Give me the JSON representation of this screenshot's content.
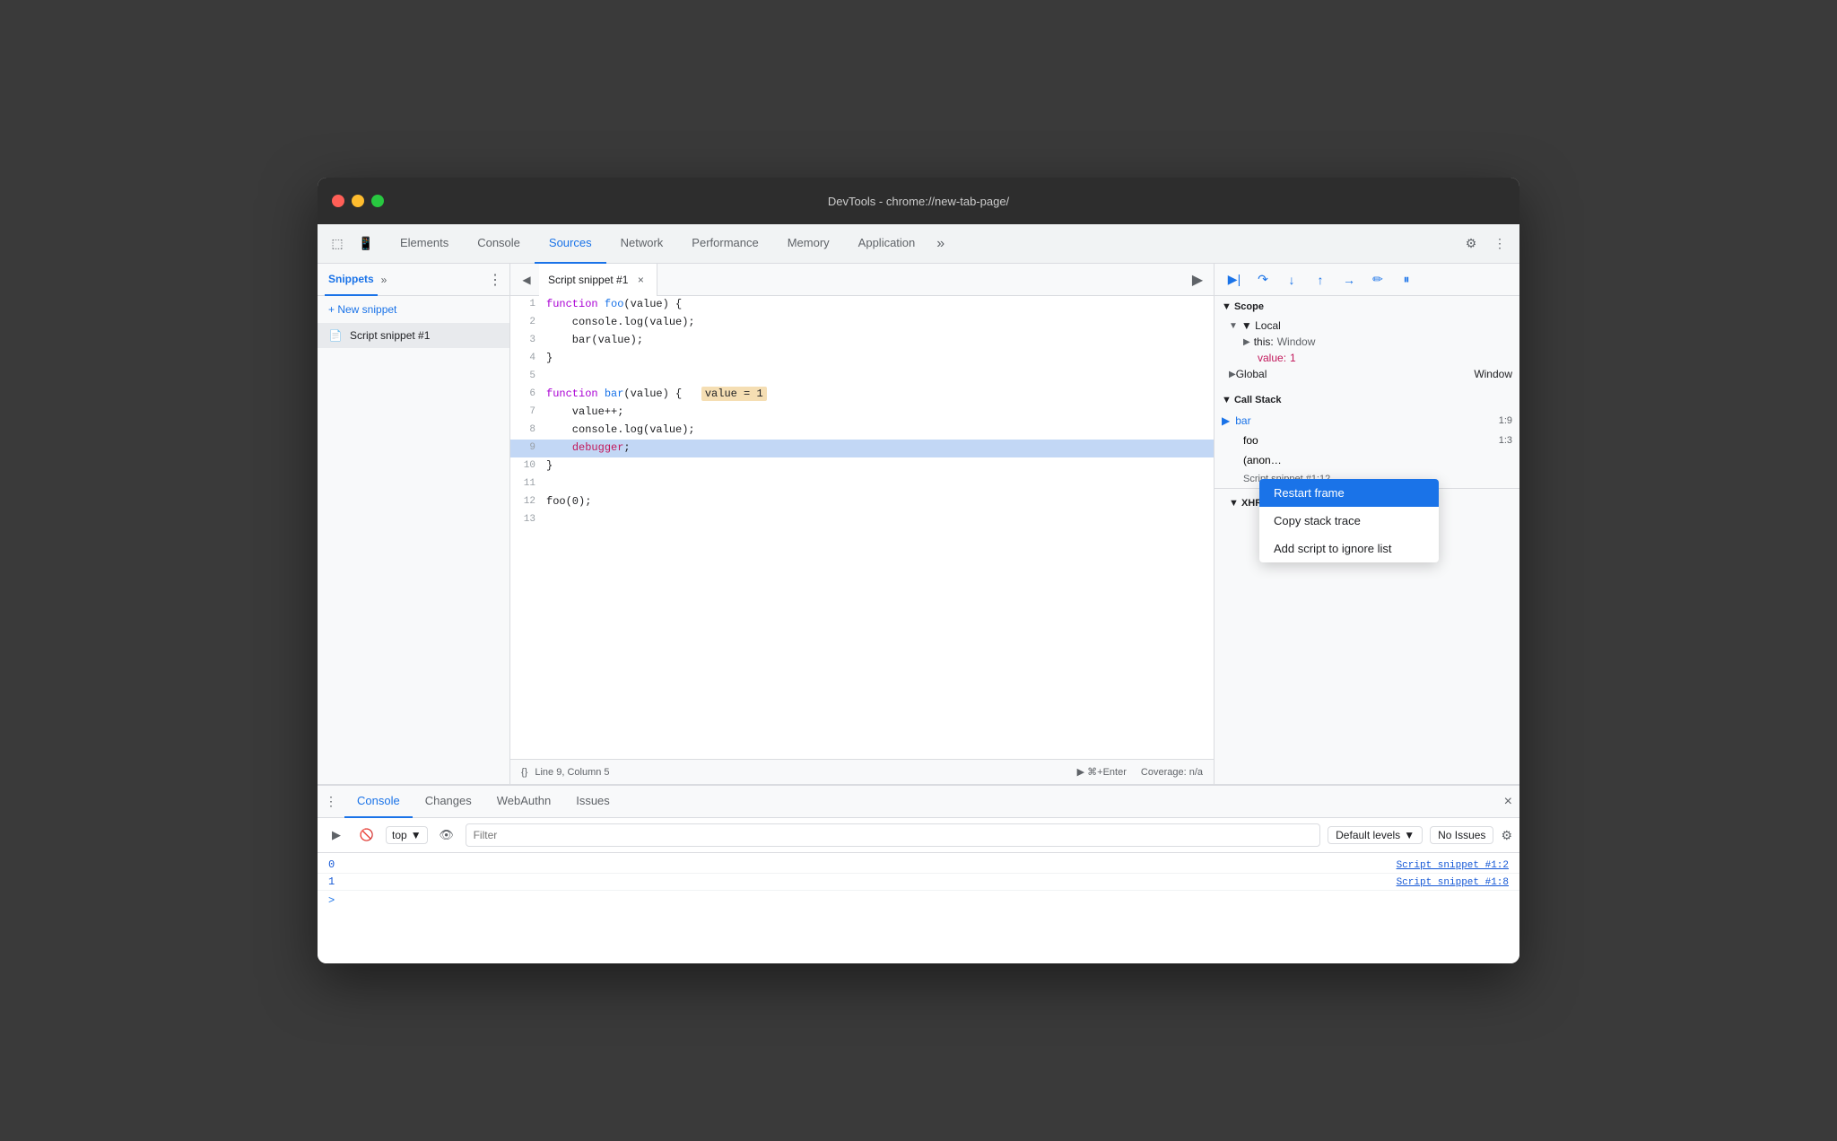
{
  "window": {
    "title": "DevTools - chrome://new-tab-page/"
  },
  "traffic_lights": {
    "red": "red",
    "yellow": "yellow",
    "green": "green"
  },
  "top_tabs": {
    "items": [
      {
        "label": "Elements",
        "active": false
      },
      {
        "label": "Console",
        "active": false
      },
      {
        "label": "Sources",
        "active": true
      },
      {
        "label": "Network",
        "active": false
      },
      {
        "label": "Performance",
        "active": false
      },
      {
        "label": "Memory",
        "active": false
      },
      {
        "label": "Application",
        "active": false
      }
    ],
    "more_label": "»",
    "settings_icon": "⚙",
    "kebab_icon": "⋮"
  },
  "sidebar": {
    "title": "Snippets",
    "more_label": "»",
    "menu_icon": "⋮",
    "new_snippet_label": "+ New snippet",
    "snippet_item": "Script snippet #1"
  },
  "editor": {
    "tab_name": "Script snippet #1",
    "close_icon": "×",
    "run_icon": "▶",
    "nav_icon": "◀",
    "lines": [
      {
        "num": "1",
        "content": "function foo(value) {",
        "highlighted": false
      },
      {
        "num": "2",
        "content": "    console.log(value);",
        "highlighted": false
      },
      {
        "num": "3",
        "content": "    bar(value);",
        "highlighted": false
      },
      {
        "num": "4",
        "content": "}",
        "highlighted": false
      },
      {
        "num": "5",
        "content": "",
        "highlighted": false
      },
      {
        "num": "6",
        "content": "function bar(value) {",
        "highlighted": false,
        "has_value_highlight": true,
        "value_highlight_text": "value = 1"
      },
      {
        "num": "7",
        "content": "    value++;",
        "highlighted": false
      },
      {
        "num": "8",
        "content": "    console.log(value);",
        "highlighted": false
      },
      {
        "num": "9",
        "content": "    debugger;",
        "highlighted": true
      },
      {
        "num": "10",
        "content": "}",
        "highlighted": false
      },
      {
        "num": "11",
        "content": "",
        "highlighted": false
      },
      {
        "num": "12",
        "content": "foo(0);",
        "highlighted": false
      },
      {
        "num": "13",
        "content": "",
        "highlighted": false
      }
    ],
    "status": {
      "format_icon": "{}",
      "position": "Line 9, Column 5",
      "run_label": "▶ ⌘+Enter",
      "coverage": "Coverage: n/a"
    }
  },
  "right_panel": {
    "debug_buttons": [
      "▶",
      "↺",
      "↓",
      "↑",
      "→",
      "✏",
      "⏸"
    ],
    "scope_section": {
      "label": "▼ Scope",
      "local_label": "▼ Local",
      "this_label": "▶ this:",
      "this_value": "Window",
      "value_key": "value:",
      "value_val": "1",
      "global_label": "▶ Global",
      "global_val": "Window"
    },
    "call_stack": {
      "label": "▼ Call Stack",
      "items": [
        {
          "name": "bar",
          "loc": "1:9",
          "active": true
        },
        {
          "name": "foo",
          "loc": "1:3",
          "active": false
        },
        {
          "name": "(anon…",
          "loc": "",
          "active": false
        }
      ],
      "script_loc": "Script snippet #1:12"
    },
    "xhr_section": {
      "label": "▼ XHR/fetch Breakpoints"
    },
    "context_menu": {
      "items": [
        {
          "label": "Restart frame",
          "selected": true
        },
        {
          "label": "Copy stack trace",
          "selected": false
        },
        {
          "label": "Add script to ignore list",
          "selected": false
        }
      ]
    }
  },
  "bottom_panel": {
    "tabs": [
      {
        "label": "Console",
        "active": true
      },
      {
        "label": "Changes",
        "active": false
      },
      {
        "label": "WebAuthn",
        "active": false
      },
      {
        "label": "Issues",
        "active": false
      }
    ],
    "toolbar": {
      "clear_icon": "🚫",
      "top_label": "top",
      "filter_placeholder": "Filter",
      "levels_label": "Default levels",
      "levels_arrow": "▼",
      "issues_label": "No Issues",
      "settings_icon": "⚙"
    },
    "console_lines": [
      {
        "value": "0",
        "source": "Script snippet #1:2"
      },
      {
        "value": "1",
        "source": "Script snippet #1:8"
      }
    ],
    "prompt_symbol": ">"
  }
}
